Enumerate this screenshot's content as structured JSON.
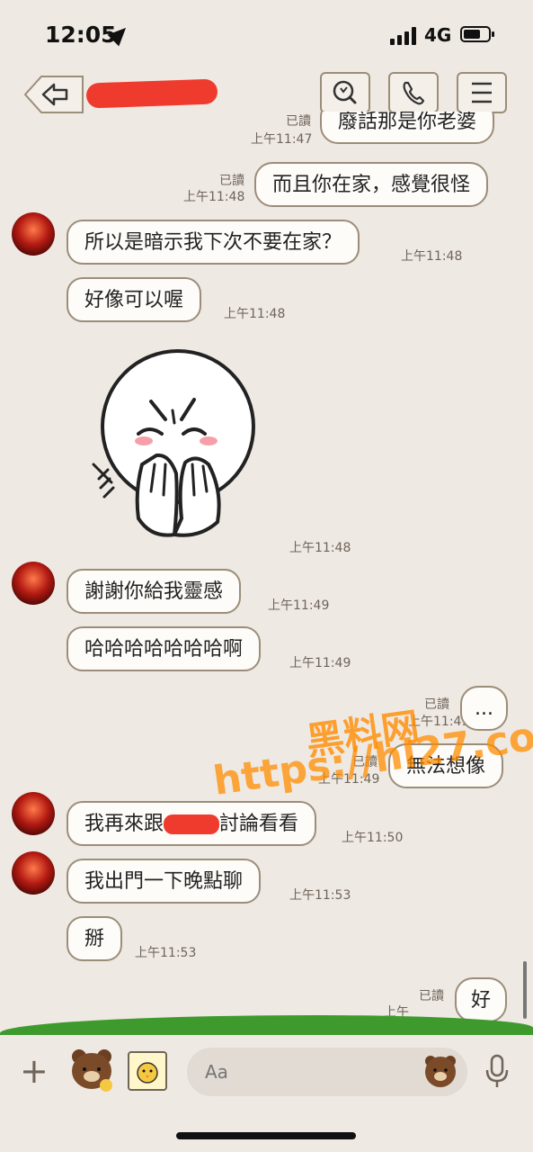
{
  "status_bar": {
    "time": "12:05",
    "network": "4G"
  },
  "header": {
    "icons": [
      "back-icon",
      "search-icon",
      "phone-icon",
      "menu-icon"
    ]
  },
  "messages": [
    {
      "dir": "out",
      "text": "廢話那是你老婆",
      "read": "已讀",
      "time": "上午11:47"
    },
    {
      "dir": "out",
      "text": "而且你在家，感覺很怪",
      "read": "已讀",
      "time": "上午11:48"
    },
    {
      "dir": "in",
      "text": "所以是暗示我下次不要在家？",
      "time": "上午11:48"
    },
    {
      "dir": "in",
      "text": "好像可以喔",
      "time": "上午11:48"
    },
    {
      "dir": "in",
      "sticker": "blushing-sticker",
      "time": "上午11:48"
    },
    {
      "dir": "in",
      "text": "謝謝你給我靈感",
      "time": "上午11:49"
    },
    {
      "dir": "in",
      "text": "哈哈哈哈哈哈哈啊",
      "time": "上午11:49"
    },
    {
      "dir": "out",
      "text": "...",
      "read": "已讀",
      "time": "上午11:49"
    },
    {
      "dir": "out",
      "text": "無法想像",
      "read": "已讀",
      "time": "上午11:49"
    },
    {
      "dir": "in",
      "text_a": "我再來跟",
      "text_b": "討論看看",
      "time": "上午11:50"
    },
    {
      "dir": "in",
      "text": "我出門一下晚點聊",
      "time": "上午11:53"
    },
    {
      "dir": "in",
      "text": "掰",
      "time": "上午11:53"
    },
    {
      "dir": "out",
      "text": "好",
      "read": "已讀",
      "time": "上午"
    }
  ],
  "watermark": {
    "line1": "黑料网",
    "line2": "https://hl27.co"
  },
  "input": {
    "placeholder": "Aa"
  },
  "colors": {
    "background": "#efe9e3",
    "bubble_border": "#9b8d7a",
    "bubble_fill": "#fefcf8",
    "redaction": "#ef3b2e",
    "watermark": "#ff8c00"
  }
}
